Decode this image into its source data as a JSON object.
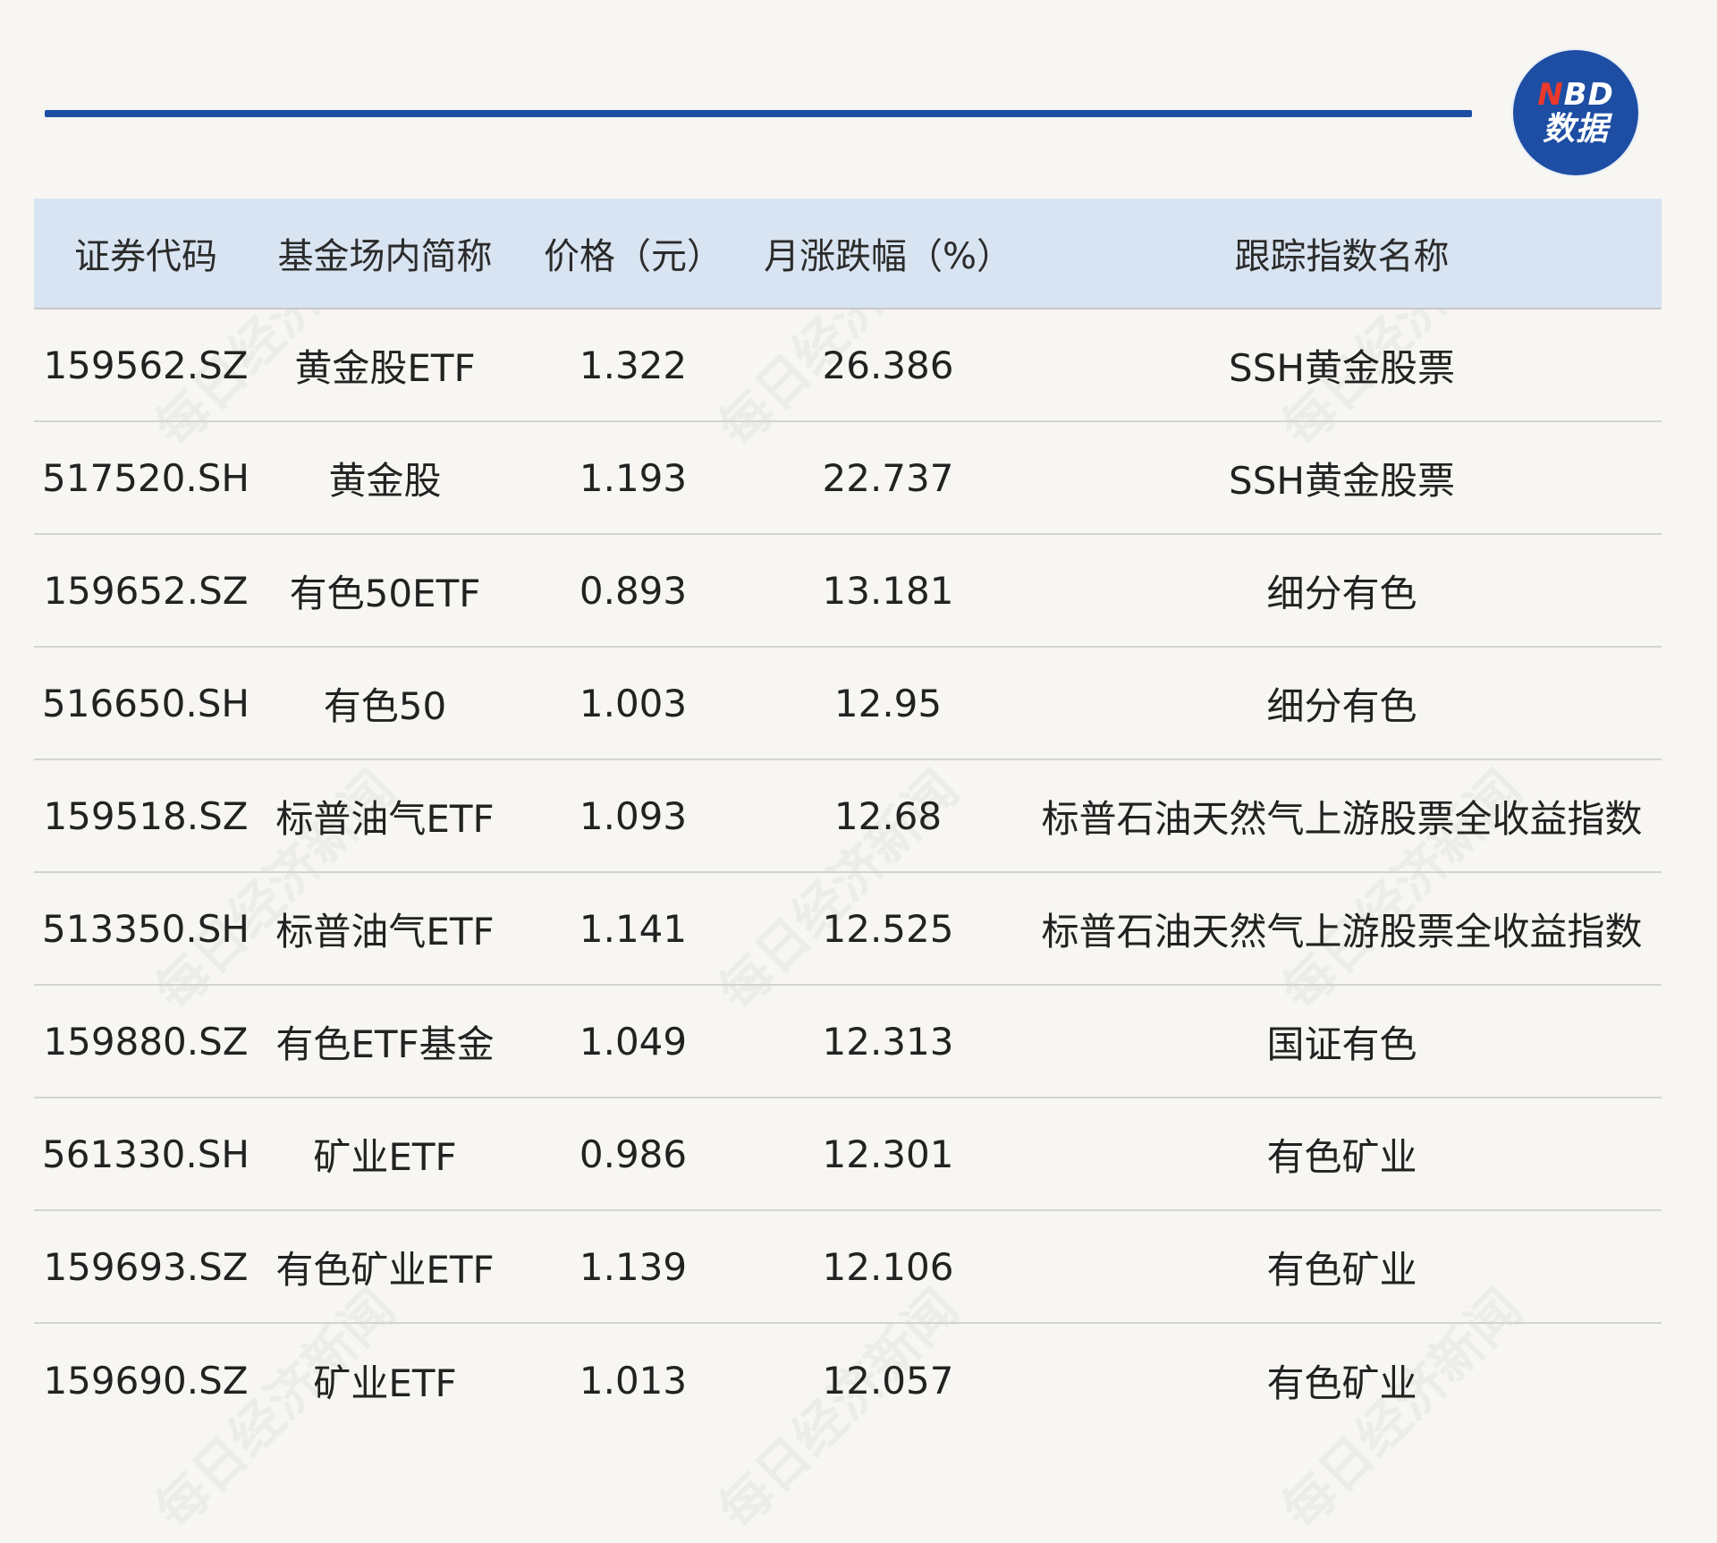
{
  "logo": {
    "line1_n": "N",
    "line1_rest": "BD",
    "line2": "数据"
  },
  "watermark": "每日经济新闻",
  "table": {
    "headers": [
      "证券代码",
      "基金场内简称",
      "价格（元）",
      "月涨跌幅（%）",
      "跟踪指数名称"
    ],
    "rows": [
      {
        "code": "159562.SZ",
        "name": "黄金股ETF",
        "price": "1.322",
        "change": "26.386",
        "index": "SSH黄金股票"
      },
      {
        "code": "517520.SH",
        "name": "黄金股",
        "price": "1.193",
        "change": "22.737",
        "index": "SSH黄金股票"
      },
      {
        "code": "159652.SZ",
        "name": "有色50ETF",
        "price": "0.893",
        "change": "13.181",
        "index": "细分有色"
      },
      {
        "code": "516650.SH",
        "name": "有色50",
        "price": "1.003",
        "change": "12.95",
        "index": "细分有色"
      },
      {
        "code": "159518.SZ",
        "name": "标普油气ETF",
        "price": "1.093",
        "change": "12.68",
        "index": "标普石油天然气上游股票全收益指数"
      },
      {
        "code": "513350.SH",
        "name": "标普油气ETF",
        "price": "1.141",
        "change": "12.525",
        "index": "标普石油天然气上游股票全收益指数"
      },
      {
        "code": "159880.SZ",
        "name": "有色ETF基金",
        "price": "1.049",
        "change": "12.313",
        "index": "国证有色"
      },
      {
        "code": "561330.SH",
        "name": "矿业ETF",
        "price": "0.986",
        "change": "12.301",
        "index": "有色矿业"
      },
      {
        "code": "159693.SZ",
        "name": "有色矿业ETF",
        "price": "1.139",
        "change": "12.106",
        "index": "有色矿业"
      },
      {
        "code": "159690.SZ",
        "name": "矿业ETF",
        "price": "1.013",
        "change": "12.057",
        "index": "有色矿业"
      }
    ]
  },
  "colors": {
    "accent": "#1d4ea3",
    "header_bg": "#d8e4f1",
    "page_bg": "#f7f6f2",
    "logo_n": "#e8392c"
  }
}
